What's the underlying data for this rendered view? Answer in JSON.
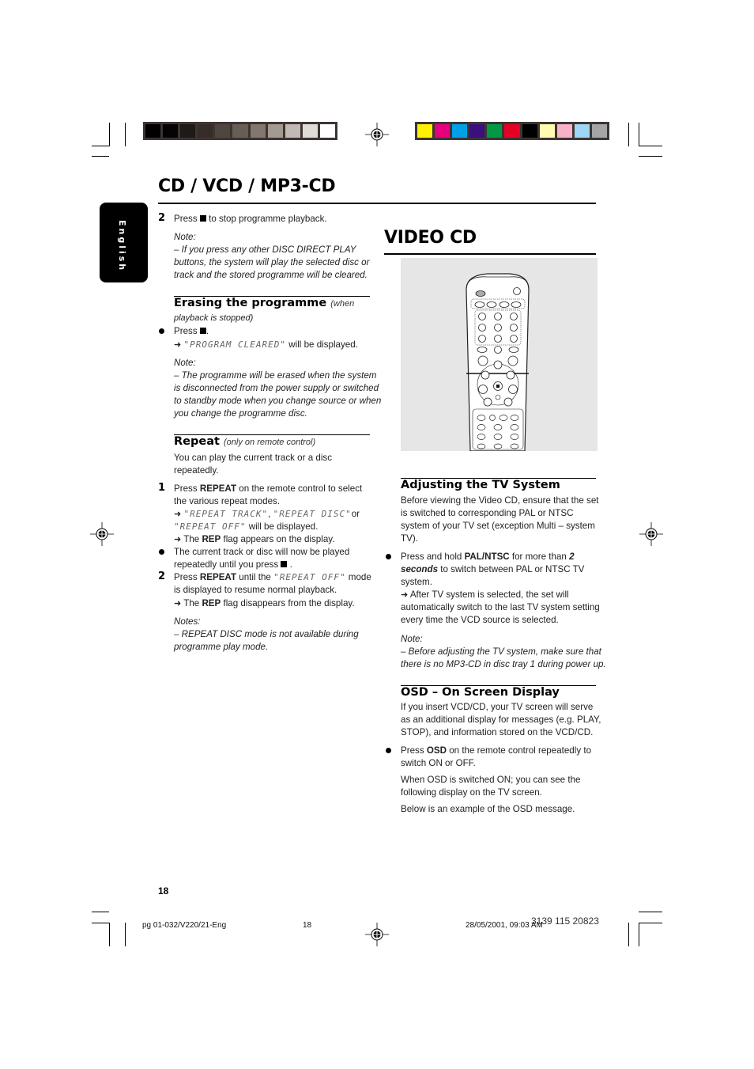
{
  "print_marks": {
    "gray_scale": [
      "#000000",
      "#050304",
      "#1e1a17",
      "#362c28",
      "#4f4640",
      "#675e58",
      "#82786f",
      "#a49a94",
      "#c2b9b4",
      "#dfdbd8",
      "#ffffff"
    ],
    "color_scale": [
      "#fff200",
      "#e6007e",
      "#00a0e9",
      "#3b0f7d",
      "#009944",
      "#e60023",
      "#000000",
      "#fff9b1",
      "#f8b1c9",
      "#a0d6f5",
      "#a5a5a5"
    ]
  },
  "page": {
    "title": "CD / VCD / MP3-CD",
    "language_tab": "English",
    "page_number": "18"
  },
  "left_column": {
    "step2": {
      "number": "2",
      "text_before": "Press",
      "text_after": "to stop programme playback.",
      "note_label": "Note:",
      "note_lines": [
        "–  If you press any other DISC DIRECT PLAY",
        "buttons, the system will play the selected disc or",
        "track and the stored programme will be cleared."
      ]
    },
    "erasing": {
      "title": "Erasing the programme",
      "subtitle_1": "(when",
      "subtitle_2": "playback is stopped)",
      "press": "Press",
      "press_end": ".",
      "display_text": "\"PROGRAM CLEARED\"",
      "display_suffix": " will be displayed.",
      "note_label": "Note:",
      "note_lines": [
        "–  The programme will be erased when the system",
        "is disconnected from the power supply or switched",
        "to standby mode when you change source or when",
        "you change the programme disc."
      ]
    },
    "repeat": {
      "title": "Repeat",
      "subtitle": "(only on remote control)",
      "intro_lines": [
        "You can play the current track or a disc",
        "repeatedly."
      ],
      "step1": {
        "number": "1",
        "l1_pre": "Press ",
        "l1_bold": "REPEAT",
        "l1_post": " on the remote control to select",
        "l2": "the various repeat modes.",
        "lcd_1": "\"REPEAT TRACK\"",
        "sep_1": ", ",
        "lcd_2": "\"REPEAT DISC\"",
        "sep_2": "or",
        "lcd_3": "\"REPEAT OFF\"",
        "l4_post": " will be displayed.",
        "l5_pre": "The ",
        "l5_bold": "REP",
        "l5_post": " flag appears on the display."
      },
      "bullet": {
        "l1": "The current track or disc will now be played",
        "l2": "repeatedly until you press",
        "l2_end": "."
      },
      "step2": {
        "number": "2",
        "l1_pre": "Press ",
        "l1_bold": "REPEAT",
        "l1_mid": " until the ",
        "lcd": "\"REPEAT OFF\"",
        "l1_post": " mode",
        "l2": "is displayed to resume normal playback.",
        "l3_pre": "The ",
        "l3_bold": "REP",
        "l3_post": " flag disappears from the display."
      },
      "notes_label": "Notes:",
      "notes_lines": [
        "–  REPEAT DISC mode is not available during",
        "programme play mode."
      ]
    }
  },
  "right_column": {
    "title": "VIDEO CD",
    "remote_image_alt": "Remote control illustration",
    "tv_system": {
      "title": "Adjusting the TV System",
      "intro_lines": [
        "Before viewing the Video CD, ensure that the set",
        "is switched to corresponding PAL or NTSC",
        "system of your TV set (exception Multi – system",
        "TV)."
      ],
      "bullet": {
        "l1_pre": "Press and hold ",
        "l1_bold": "PAL/NTSC",
        "l1_mid": " for more than ",
        "l1_bold2": "2",
        "l2_bolditalic": "seconds",
        "l2_post": " to switch between PAL or NTSC TV",
        "l3": "system.",
        "l4": "After TV system is selected, the set will",
        "l5": "automatically switch to the last TV system setting",
        "l6": "every time the VCD source is selected."
      },
      "note_label": "Note:",
      "note_lines": [
        "–  Before adjusting the TV system, make sure that",
        "there is no MP3-CD in disc tray 1 during power up."
      ]
    },
    "osd": {
      "title": "OSD – On Screen Display",
      "intro_lines": [
        "If you insert VCD/CD, your TV screen will serve",
        "as an additional display for messages (e.g. PLAY,",
        "STOP), and information stored on the VCD/CD."
      ],
      "bullet": {
        "l1_pre": "Press ",
        "l1_bold": "OSD",
        "l1_post": " on the remote control repeatedly to",
        "l2": "switch ON or OFF."
      },
      "para1_lines": [
        "When OSD is switched ON; you can see the",
        "following display on the TV screen."
      ],
      "para2": "Below is an example of the OSD message."
    }
  },
  "footer": {
    "page_number": "18",
    "slug_file": "pg 01-032/V220/21-Eng",
    "slug_page": "18",
    "slug_date": "28/05/2001, 09:03 AM",
    "part_code": "3139 115 20823"
  }
}
